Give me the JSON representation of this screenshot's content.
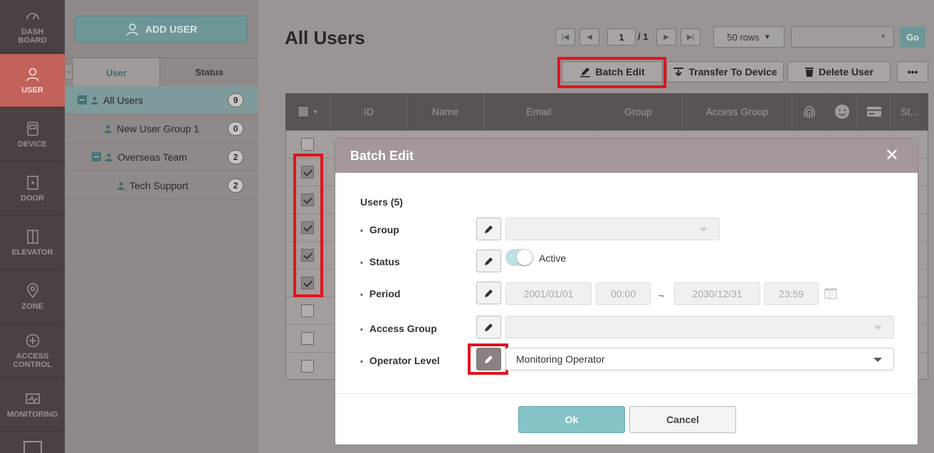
{
  "sidebar": {
    "items": [
      {
        "label": "DASH\nBOARD",
        "icon": "gauge-icon"
      },
      {
        "label": "USER",
        "icon": "user-icon"
      },
      {
        "label": "DEVICE",
        "icon": "device-icon"
      },
      {
        "label": "DOOR",
        "icon": "door-icon"
      },
      {
        "label": "ELEVATOR",
        "icon": "elevator-icon"
      },
      {
        "label": "ZONE",
        "icon": "map-pin-icon"
      },
      {
        "label": "ACCESS\nCONTROL",
        "icon": "access-control-icon"
      },
      {
        "label": "MONITORING",
        "icon": "monitoring-icon"
      }
    ],
    "active": "USER"
  },
  "groups_panel": {
    "add_user_label": "ADD USER",
    "tabs": [
      "User",
      "Status"
    ],
    "groups": [
      {
        "name": "All Users",
        "count": "9"
      },
      {
        "name": "New User Group 1",
        "count": "0"
      },
      {
        "name": "Overseas Team",
        "count": "2"
      },
      {
        "name": "Tech Support",
        "count": "2"
      }
    ]
  },
  "main": {
    "title": "All Users",
    "pager": {
      "page": "1",
      "total": "/ 1"
    },
    "rows_per_page": "50 rows",
    "go_label": "Go",
    "toolbar": {
      "batch_edit": "Batch Edit",
      "transfer": "Transfer To Device",
      "delete": "Delete User",
      "more": "•••"
    },
    "columns": [
      "ID",
      "Name",
      "Email",
      "Group",
      "Access Group",
      "St..."
    ],
    "row_checks": [
      false,
      true,
      true,
      true,
      true,
      true,
      false,
      false,
      false
    ]
  },
  "modal": {
    "title": "Batch Edit",
    "users_count": "Users (5)",
    "fields": {
      "group": "Group",
      "status": "Status",
      "period": "Period",
      "access_group": "Access Group",
      "operator_level": "Operator Level"
    },
    "status_value": "Active",
    "period": {
      "start_date": "2001/01/01",
      "start_time": "00:00",
      "separator": "~",
      "end_date": "2030/12/31",
      "end_time": "23:59"
    },
    "operator_level_value": "Monitoring Operator",
    "ok_label": "Ok",
    "cancel_label": "Cancel"
  },
  "colors": {
    "accent": "#84c4c8",
    "highlight": "#e0141e",
    "active_nav": "#c2625a"
  }
}
